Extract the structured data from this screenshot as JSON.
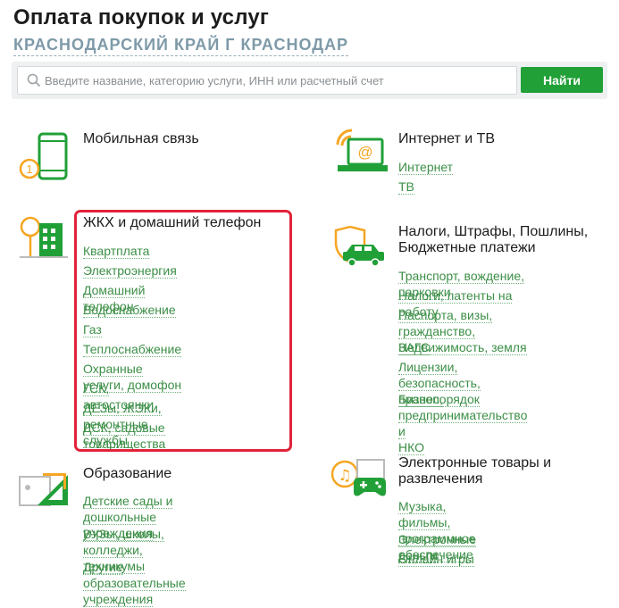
{
  "page": {
    "title": "Оплата покупок и услуг",
    "region": "КРАСНОДАРСКИЙ КРАЙ Г КРАСНОДАР"
  },
  "search": {
    "placeholder": "Введите название, категорию услуги, ИНН или расчетный счет",
    "button_label": "Найти"
  },
  "colors": {
    "accent_green": "#21a038",
    "link_green": "#3c8f47",
    "icon_orange": "#f5a623",
    "highlight_red": "#e2233a"
  },
  "categories": {
    "mobile": {
      "icon": "mobile-phone-icon",
      "title": "Мобильная связь",
      "links": []
    },
    "internet": {
      "icon": "internet-tv-icon",
      "title": "Интернет и ТВ",
      "links": [
        "Интернет",
        "ТВ"
      ]
    },
    "housing": {
      "icon": "house-icon",
      "title": "ЖКХ и домашний телефон",
      "links": [
        "Квартплата",
        "Электроэнергия",
        "Домашний телефон",
        "Водоснабжение",
        "Газ",
        "Теплоснабжение",
        "Охранные услуги, домофон",
        "ГСК, автостоянки",
        "ДЕЗы, ЖЭКи, ремонтные службы",
        "ДСК, садовые товарищества"
      ]
    },
    "taxes": {
      "icon": "car-shield-icon",
      "title_lines": [
        "Налоги, Штрафы, Пошлины,",
        "Бюджетные платежи"
      ],
      "links": [
        [
          "Транспорт, вождение, парковки"
        ],
        [
          "Налоги, патенты на работу"
        ],
        [
          "Паспорта, визы, гражданство,",
          "ЗАГС"
        ],
        [
          "Недвижимость, земля"
        ],
        [
          "Лицензии, безопасность,",
          "правопорядок"
        ],
        [
          "Бизнес, предпринимательство и",
          "НКО"
        ]
      ]
    },
    "education": {
      "icon": "education-icon",
      "title": "Образование",
      "links": [
        [
          "Детские сады и дошкольные",
          "учреждения"
        ],
        [
          "ВУЗы, школы, колледжи,",
          "техникумы"
        ],
        [
          "Другие образовательные",
          "учреждения"
        ]
      ]
    },
    "electronic": {
      "icon": "gamepad-music-icon",
      "title_lines": [
        "Электронные товары и",
        "развлечения"
      ],
      "links": [
        [
          "Музыка, фильмы, программное",
          "обеспечение"
        ],
        [
          "Электронные деньги"
        ],
        [
          "Онлайн игры"
        ]
      ]
    }
  }
}
